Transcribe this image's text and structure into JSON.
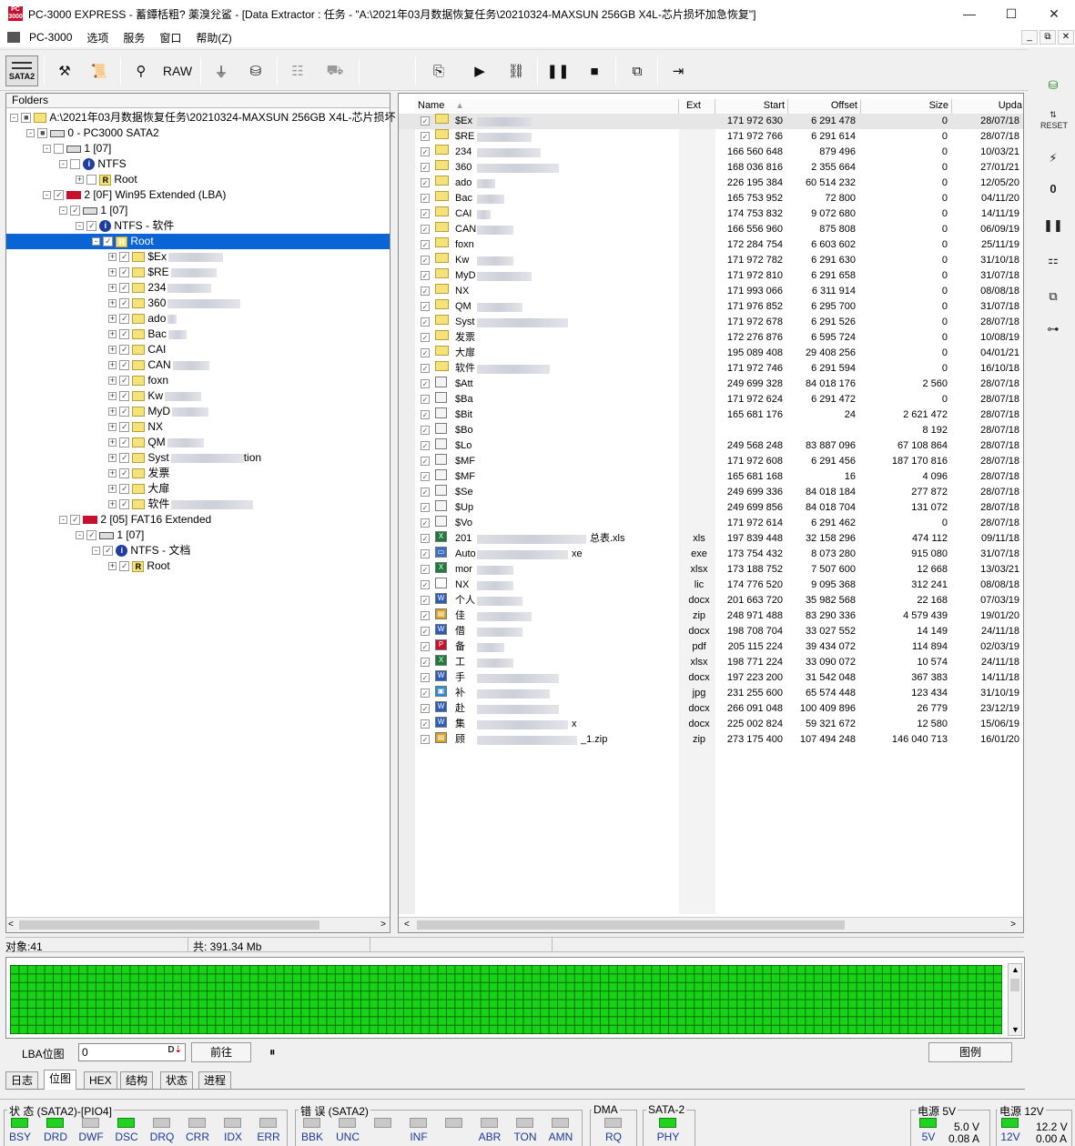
{
  "titlebar": {
    "title": "PC-3000 EXPRESS - 蓄鐔栝粗? 薬溴兊鲨     - [Data Extractor : 任务 - \"A:\\2021年03月数据恢复任务\\20210324-MAXSUN  256GB X4L-芯片损坏加急恢复\"]",
    "minimize": "—",
    "maximize": "☐",
    "close": "✕"
  },
  "menubar": {
    "items": [
      "PC-3000",
      "选项",
      "服务",
      "窗口",
      "帮助(Z)"
    ],
    "mdi": [
      "_",
      "⧉",
      "✕"
    ]
  },
  "toolbar": {
    "sata_label": "SATA2",
    "raw_label": "RAW"
  },
  "folders": {
    "header": "Folders",
    "rows": [
      {
        "text": "A:\\2021年03月数据恢复任务\\20210324-MAXSUN  256GB X4L-芯片损坏"
      },
      {
        "text": "0 - PC3000 SATA2"
      },
      {
        "text": "1 [07]"
      },
      {
        "text": "NTFS"
      },
      {
        "text": "Root"
      },
      {
        "text": "2 [0F] Win95 Extended  (LBA)"
      },
      {
        "text": "1 [07]"
      },
      {
        "text": "NTFS - 软件"
      },
      {
        "text": "Root"
      },
      {
        "text": "$Ex"
      },
      {
        "text": "$RE"
      },
      {
        "text": "234"
      },
      {
        "text": "360"
      },
      {
        "text": "ado"
      },
      {
        "text": "Bac"
      },
      {
        "text": "CAI"
      },
      {
        "text": "CAN"
      },
      {
        "text": "foxn"
      },
      {
        "text": "Kw"
      },
      {
        "text": "MyD"
      },
      {
        "text": "NX"
      },
      {
        "text": "QM"
      },
      {
        "text": "Syst"
      },
      {
        "text": "发票"
      },
      {
        "text": "大扉"
      },
      {
        "text": "软件"
      },
      {
        "text": "2 [05] FAT16 Extended"
      },
      {
        "text": "1 [07]"
      },
      {
        "text": "NTFS - 文档"
      },
      {
        "text": "Root"
      }
    ],
    "extra_tion": "tion"
  },
  "filelist": {
    "headers": {
      "name": "Name",
      "ext": "Ext",
      "start": "Start",
      "offset": "Offset",
      "size": "Size",
      "upd": "Upda"
    },
    "rows": [
      {
        "name": "$Ex",
        "ext": "",
        "start": "171 972 630",
        "offset": "6 291 478",
        "size": "0",
        "upd": "28/07/18"
      },
      {
        "name": "$RE",
        "ext": "",
        "start": "171 972 766",
        "offset": "6 291 614",
        "size": "0",
        "upd": "28/07/18"
      },
      {
        "name": "234",
        "ext": "",
        "start": "166 560 648",
        "offset": "879 496",
        "size": "0",
        "upd": "10/03/21"
      },
      {
        "name": "360",
        "ext": "",
        "start": "168 036 816",
        "offset": "2 355 664",
        "size": "0",
        "upd": "27/01/21"
      },
      {
        "name": "ado",
        "ext": "",
        "start": "226 195 384",
        "offset": "60 514 232",
        "size": "0",
        "upd": "12/05/20"
      },
      {
        "name": "Bac",
        "ext": "",
        "start": "165 753 952",
        "offset": "72 800",
        "size": "0",
        "upd": "04/11/20"
      },
      {
        "name": "CAI",
        "ext": "",
        "start": "174 753 832",
        "offset": "9 072 680",
        "size": "0",
        "upd": "14/11/19"
      },
      {
        "name": "CAN",
        "ext": "",
        "start": "166 556 960",
        "offset": "875 808",
        "size": "0",
        "upd": "06/09/19"
      },
      {
        "name": "foxn",
        "ext": "",
        "start": "172 284 754",
        "offset": "6 603 602",
        "size": "0",
        "upd": "25/11/19"
      },
      {
        "name": "Kw",
        "ext": "",
        "start": "171 972 782",
        "offset": "6 291 630",
        "size": "0",
        "upd": "31/10/18"
      },
      {
        "name": "MyD",
        "ext": "",
        "start": "171 972 810",
        "offset": "6 291 658",
        "size": "0",
        "upd": "31/07/18"
      },
      {
        "name": "NX",
        "ext": "",
        "start": "171 993 066",
        "offset": "6 311 914",
        "size": "0",
        "upd": "08/08/18"
      },
      {
        "name": "QM",
        "ext": "",
        "start": "171 976 852",
        "offset": "6 295 700",
        "size": "0",
        "upd": "31/07/18"
      },
      {
        "name": "Syst",
        "ext": "",
        "start": "171 972 678",
        "offset": "6 291 526",
        "size": "0",
        "upd": "28/07/18"
      },
      {
        "name": "发票",
        "ext": "",
        "start": "172 276 876",
        "offset": "6 595 724",
        "size": "0",
        "upd": "10/08/19"
      },
      {
        "name": "大扉",
        "ext": "",
        "start": "195 089 408",
        "offset": "29 408 256",
        "size": "0",
        "upd": "04/01/21"
      },
      {
        "name": "软件",
        "ext": "",
        "start": "171 972 746",
        "offset": "6 291 594",
        "size": "0",
        "upd": "16/10/18"
      },
      {
        "name": "$Att",
        "ext": "",
        "start": "249 699 328",
        "offset": "84 018 176",
        "size": "2 560",
        "upd": "28/07/18"
      },
      {
        "name": "$Ba",
        "ext": "",
        "start": "171 972 624",
        "offset": "6 291 472",
        "size": "0",
        "upd": "28/07/18"
      },
      {
        "name": "$Bit",
        "ext": "",
        "start": "165 681 176",
        "offset": "24",
        "size": "2 621 472",
        "upd": "28/07/18"
      },
      {
        "name": "$Bo",
        "ext": "",
        "start": "",
        "offset": "",
        "size": "8 192",
        "upd": "28/07/18"
      },
      {
        "name": "$Lo",
        "ext": "",
        "start": "249 568 248",
        "offset": "83 887 096",
        "size": "67 108 864",
        "upd": "28/07/18"
      },
      {
        "name": "$MF",
        "ext": "",
        "start": "171 972 608",
        "offset": "6 291 456",
        "size": "187 170 816",
        "upd": "28/07/18"
      },
      {
        "name": "$MF",
        "ext": "",
        "start": "165 681 168",
        "offset": "16",
        "size": "4 096",
        "upd": "28/07/18"
      },
      {
        "name": "$Se",
        "ext": "",
        "start": "249 699 336",
        "offset": "84 018 184",
        "size": "277 872",
        "upd": "28/07/18"
      },
      {
        "name": "$Up",
        "ext": "",
        "start": "249 699 856",
        "offset": "84 018 704",
        "size": "131 072",
        "upd": "28/07/18"
      },
      {
        "name": "$Vo",
        "ext": "",
        "start": "171 972 614",
        "offset": "6 291 462",
        "size": "0",
        "upd": "28/07/18"
      },
      {
        "name": "201",
        "tail": "总表.xls",
        "ext": "xls",
        "start": "197 839 448",
        "offset": "32 158 296",
        "size": "474 112",
        "upd": "09/11/18"
      },
      {
        "name": "Auto",
        "tail": "xe",
        "ext": "exe",
        "start": "173 754 432",
        "offset": "8 073 280",
        "size": "915 080",
        "upd": "31/07/18"
      },
      {
        "name": "mor",
        "ext": "xlsx",
        "start": "173 188 752",
        "offset": "7 507 600",
        "size": "12 668",
        "upd": "13/03/21"
      },
      {
        "name": "NX",
        "ext": "lic",
        "start": "174 776 520",
        "offset": "9 095 368",
        "size": "312 241",
        "upd": "08/08/18"
      },
      {
        "name": "个人",
        "ext": "docx",
        "start": "201 663 720",
        "offset": "35 982 568",
        "size": "22 168",
        "upd": "07/03/19"
      },
      {
        "name": "佳",
        "ext": "zip",
        "start": "248 971 488",
        "offset": "83 290 336",
        "size": "4 579 439",
        "upd": "19/01/20"
      },
      {
        "name": "借",
        "ext": "docx",
        "start": "198 708 704",
        "offset": "33 027 552",
        "size": "14 149",
        "upd": "24/11/18"
      },
      {
        "name": "备",
        "ext": "pdf",
        "start": "205 115 224",
        "offset": "39 434 072",
        "size": "114 894",
        "upd": "02/03/19"
      },
      {
        "name": "工",
        "ext": "xlsx",
        "start": "198 771 224",
        "offset": "33 090 072",
        "size": "10 574",
        "upd": "24/11/18"
      },
      {
        "name": "手",
        "ext": "docx",
        "start": "197 223 200",
        "offset": "31 542 048",
        "size": "367 383",
        "upd": "14/11/18"
      },
      {
        "name": "补",
        "ext": "jpg",
        "start": "231 255 600",
        "offset": "65 574 448",
        "size": "123 434",
        "upd": "31/10/19"
      },
      {
        "name": "赴",
        "ext": "docx",
        "start": "266 091 048",
        "offset": "100 409 896",
        "size": "26 779",
        "upd": "23/12/19"
      },
      {
        "name": "集",
        "tail": "x",
        "ext": "docx",
        "start": "225 002 824",
        "offset": "59 321 672",
        "size": "12 580",
        "upd": "15/06/19"
      },
      {
        "name": "顾",
        "tail": "_1.zip",
        "ext": "zip",
        "start": "273 175 400",
        "offset": "107 494 248",
        "size": "146 040 713",
        "upd": "16/01/20"
      }
    ]
  },
  "objbar": {
    "count": "对象:41",
    "total": "共:  391.34 Mb"
  },
  "lba": {
    "label": "LBA位图",
    "value": "0",
    "prev_button": "前往",
    "pause": "⏸",
    "legend_button": "图例"
  },
  "tabs": [
    "日志",
    "位图",
    "HEX",
    "结构",
    "状态",
    "进程"
  ],
  "status": {
    "state_group": "状 态 (SATA2)-[PIO4]",
    "state_leds": [
      {
        "label": "BSY",
        "on": true
      },
      {
        "label": "DRD",
        "on": true
      },
      {
        "label": "DWF",
        "on": false
      },
      {
        "label": "DSC",
        "on": true
      },
      {
        "label": "DRQ",
        "on": false
      },
      {
        "label": "CRR",
        "on": false
      },
      {
        "label": "IDX",
        "on": false
      },
      {
        "label": "ERR",
        "on": false
      }
    ],
    "error_group": "错 误 (SATA2)",
    "error_leds": [
      {
        "label": "BBK",
        "on": false
      },
      {
        "label": "UNC",
        "on": false
      },
      {
        "label": "",
        "on": false
      },
      {
        "label": "INF",
        "on": false
      },
      {
        "label": "",
        "on": false
      },
      {
        "label": "ABR",
        "on": false
      },
      {
        "label": "TON",
        "on": false
      },
      {
        "label": "AMN",
        "on": false
      }
    ],
    "dma_group": "DMA",
    "dma_led": {
      "label": "RQ",
      "on": false
    },
    "sata_group": "SATA-2",
    "sata_led": {
      "label": "PHY",
      "on": true
    },
    "power5_group": "电源 5V",
    "power5_led": {
      "label": "5V",
      "on": true
    },
    "power5_v": "5.0 V",
    "power5_a": "0.08 A",
    "power12_group": "电源 12V",
    "power12_led": {
      "label": "12V",
      "on": true
    },
    "power12_v": "12.2 V",
    "power12_a": "0.00 A"
  },
  "colors": {
    "selection": "#0a64d6",
    "led_on": "#1fd41f",
    "led_off": "#c8c8c8",
    "bitmap_green": "#17d217"
  }
}
